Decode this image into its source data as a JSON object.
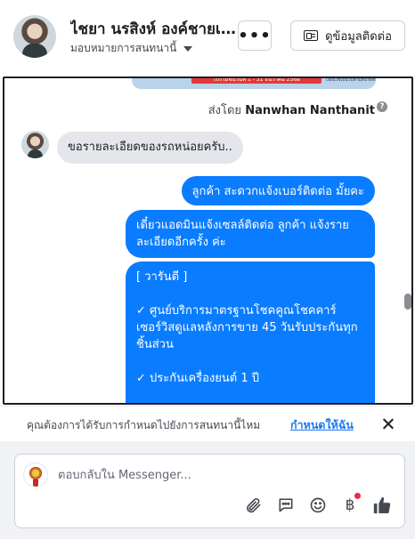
{
  "header": {
    "name": "ไชยา นรสิงห์ องค์ชายเจ้...",
    "assign_label": "มอบหมายการสนทนานี้",
    "more_label": "•••",
    "contact_label": "ดูข้อมูลติดต่อ"
  },
  "conversation": {
    "promo_banner": "โปรโมชั่นวันที่ 1 - 31 ธันวาคม 2568",
    "promo_small": "เงื่อนไขเป็นไปตามที่บริษัทกำหนด",
    "sent_by_prefix": "ส่งโดย",
    "sent_by_name": "Nanwhan Nanthanit",
    "incoming_message": "ขอรายละเอียดของรถหน่อยครับ..",
    "outgoing_messages": [
      "ลูกค้า สะดวกแจ้งเบอร์ติดต่อ มั้ยคะ",
      "เดี๋ยวแอดมินแจ้งเซลล์ติดต่อ ลูกค้า  แจ้งรายละเอียดอีกครั้ง ค่ะ"
    ],
    "details": {
      "heading": "[ วารันตี ]",
      "item1": "✓ ศูนย์บริการมาตรฐานโชคคูณโชคคาร์ เซอร์วิสดูแลหลังการขาย 45 วันรับประกันทุกชิ้นส่วน",
      "item2": "✓ ประกันเครื่องยนต์ 1 ปี"
    }
  },
  "assign_bar": {
    "question": "คุณต้องการได้รับการกำหนดไปยังการสนทนานี้ไหม",
    "assign_me": "กำหนดให้ฉัน"
  },
  "composer": {
    "placeholder": "ตอบกลับใน Messenger...",
    "icons": [
      "paperclip-icon",
      "chat-icon",
      "emoji-icon",
      "baht-icon",
      "thumbs-up-icon"
    ]
  },
  "colors": {
    "bubble_out": "#0a7cff",
    "bubble_in": "#e4e6eb",
    "link": "#1877f2",
    "notification_dot": "#f02849"
  }
}
